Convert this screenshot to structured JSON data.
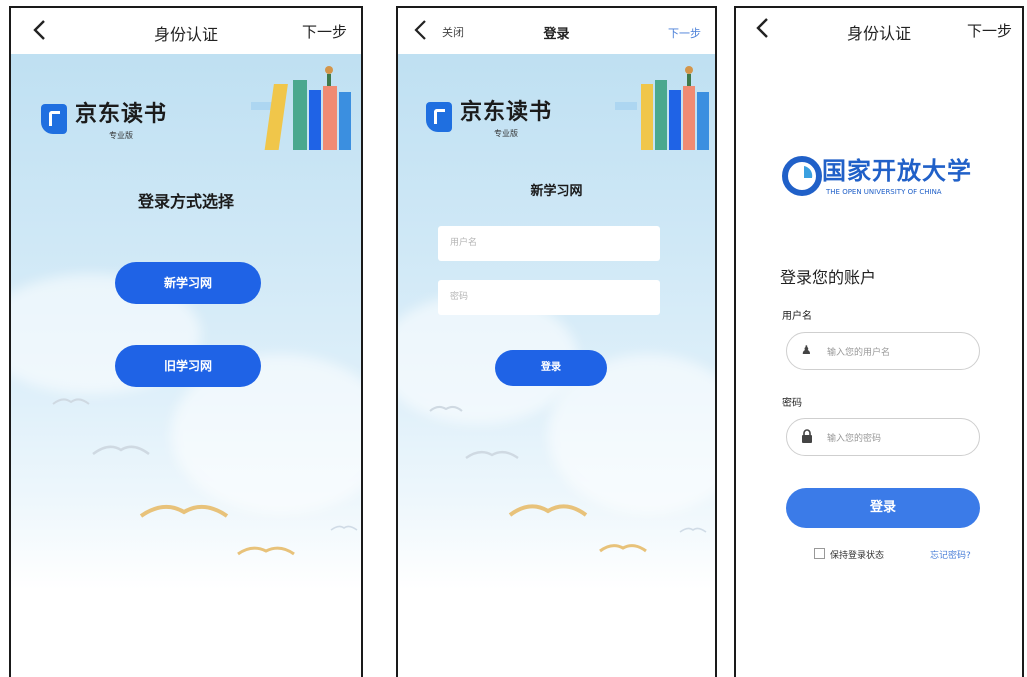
{
  "screen1": {
    "title": "身份认证",
    "next": "下一步",
    "brand": "京东读书",
    "brand_sub": "专业版",
    "heading": "登录方式选择",
    "buttons": [
      "新学习网",
      "旧学习网"
    ]
  },
  "screen2": {
    "close": "关闭",
    "title": "登录",
    "next": "下一步",
    "brand": "京东读书",
    "brand_sub": "专业版",
    "heading": "新学习网",
    "username_placeholder": "用户名",
    "password_placeholder": "密码",
    "login": "登录"
  },
  "screen3": {
    "title": "身份认证",
    "next": "下一步",
    "uni_name": "国家开放大学",
    "uni_en": "THE OPEN UNIVERSITY OF CHINA",
    "heading": "登录您的账户",
    "username_label": "用户名",
    "username_placeholder": "输入您的用户名",
    "password_label": "密码",
    "password_placeholder": "输入您的密码",
    "login": "登录",
    "remember": "保持登录状态",
    "forgot": "忘记密码?"
  },
  "colors": {
    "primary_blue": "#1f63e6",
    "link_blue": "#4a7fd8",
    "university_blue": "#2060c8"
  }
}
